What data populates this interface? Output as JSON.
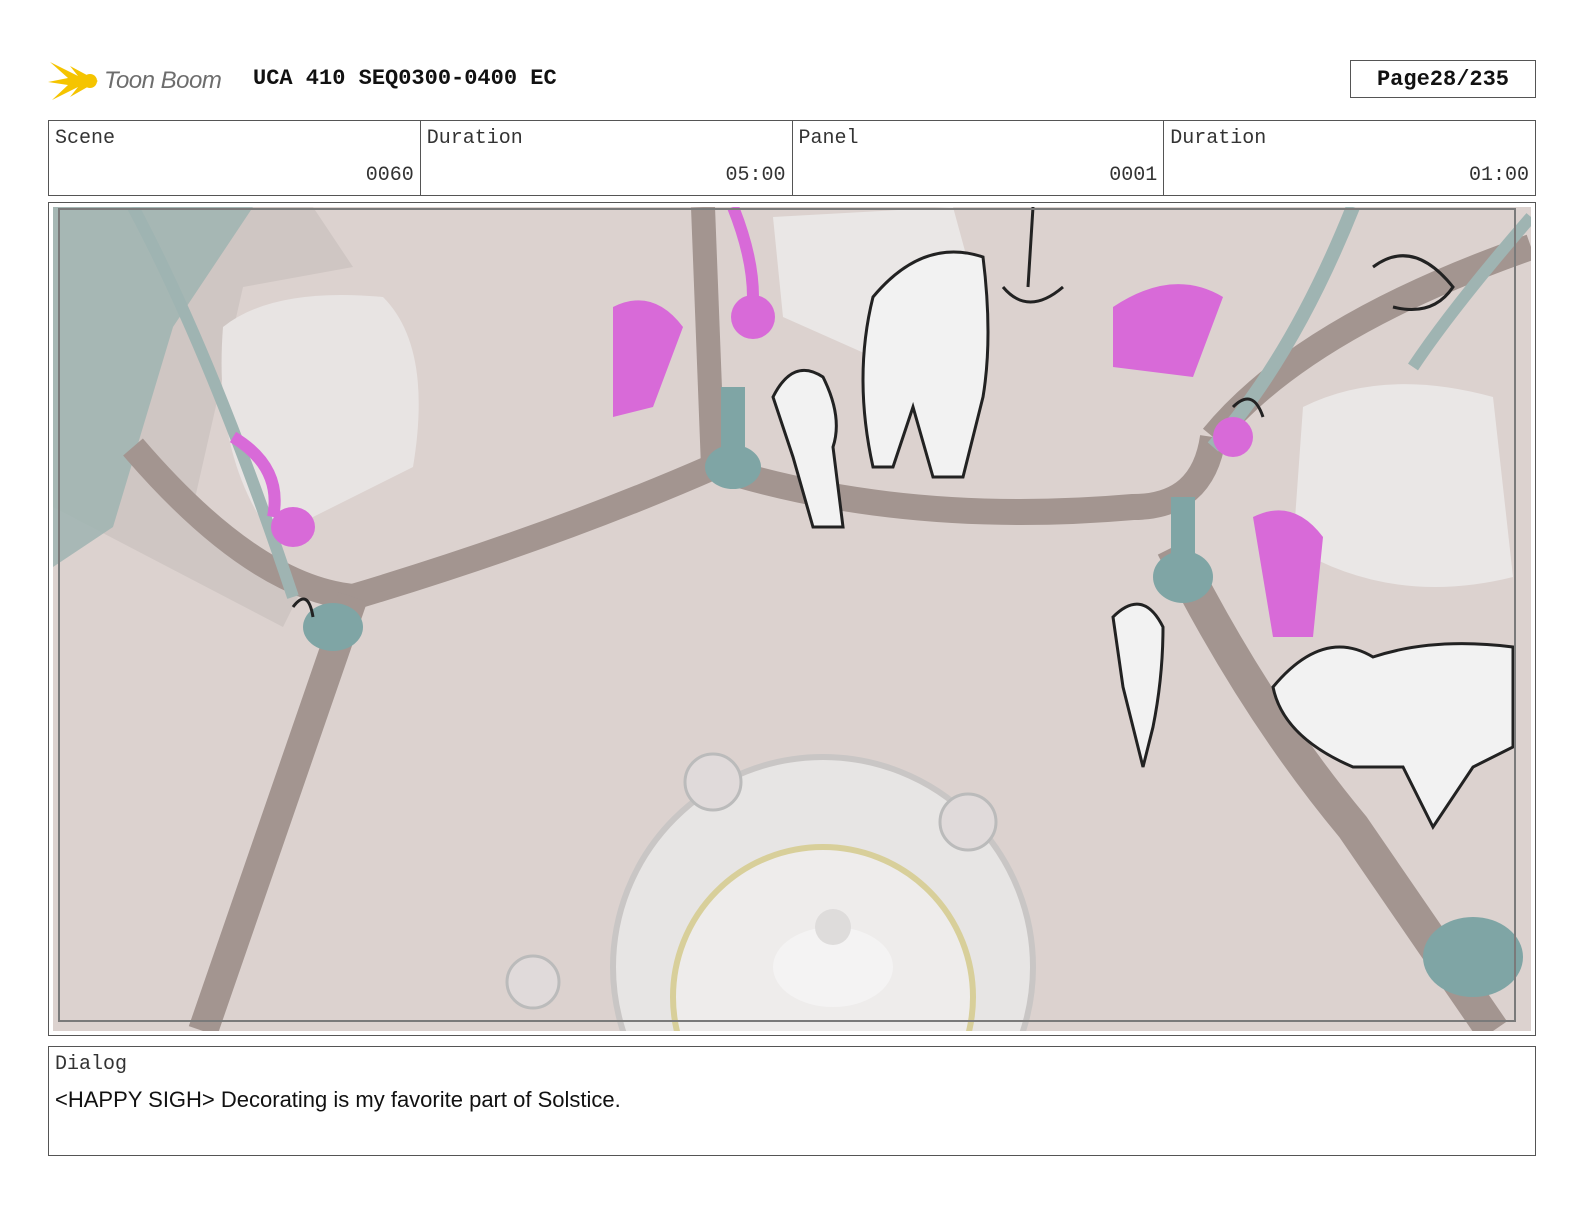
{
  "header": {
    "logo_text": "Toon Boom",
    "project_title": "UCA 410 SEQ0300-0400 EC",
    "page_label": "Page",
    "page_number": "28/235"
  },
  "info": {
    "scene_label": "Scene",
    "scene_value": "0060",
    "scene_duration_label": "Duration",
    "scene_duration_value": "05:00",
    "panel_label": "Panel",
    "panel_value": "0001",
    "panel_duration_label": "Duration",
    "panel_duration_value": "01:00"
  },
  "dialog": {
    "label": "Dialog",
    "text": "<HAPPY SIGH> Decorating is my favorite part of Solstice."
  },
  "colors": {
    "floor": "#d9cfcc",
    "beam": "#a39590",
    "teal": "#7fa5a5",
    "magenta": "#d86ad8",
    "logo_yellow": "#f5c400"
  },
  "icons": {
    "logo": "toon-boom-burst-icon"
  }
}
